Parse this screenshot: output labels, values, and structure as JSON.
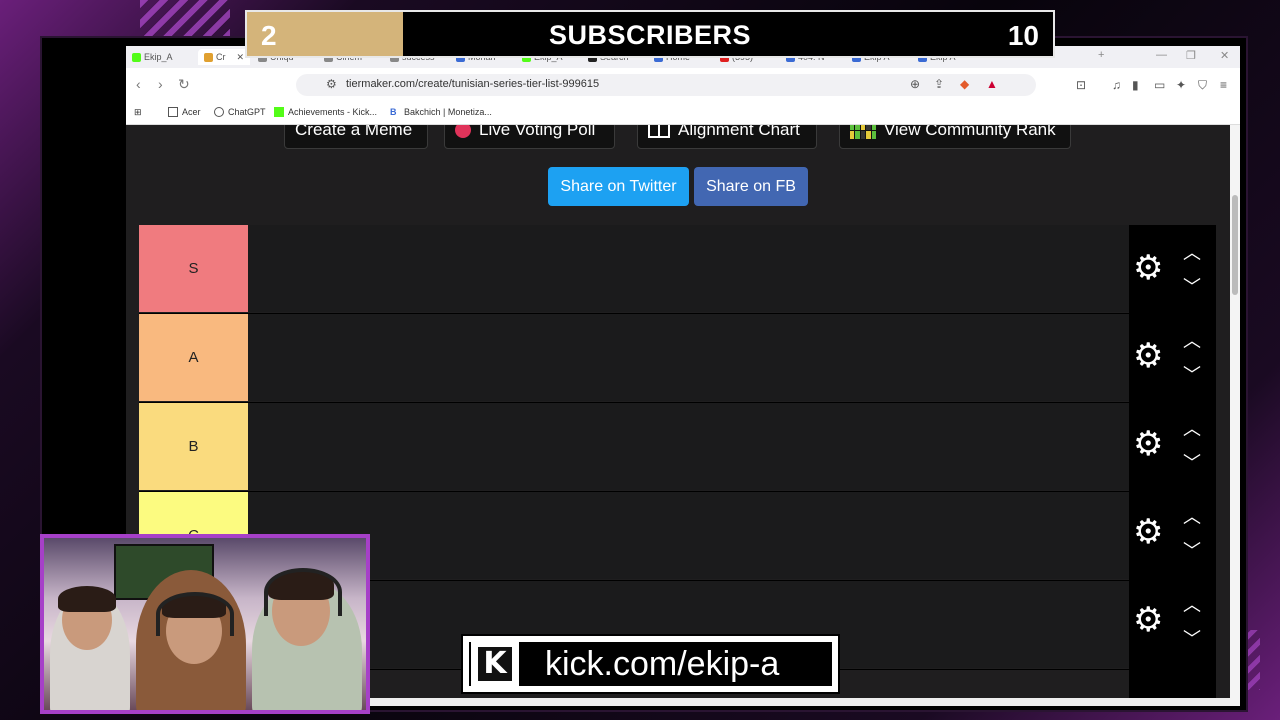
{
  "goal": {
    "current": "2",
    "title": "SUBSCRIBERS",
    "target": "10",
    "progress": 0.2
  },
  "browser": {
    "tabs": [
      {
        "label": "Ekip_A",
        "color": "#53fc18"
      },
      {
        "label": "Cr",
        "color": "#e0a030",
        "active": true
      },
      {
        "label": "Uniqu",
        "color": "#888888"
      },
      {
        "label": "Cinem",
        "color": "#888888"
      },
      {
        "label": "success",
        "color": "#888888"
      },
      {
        "label": "Mohan",
        "color": "#3a6ad4"
      },
      {
        "label": "Ekip_A",
        "color": "#53fc18"
      },
      {
        "label": "Search",
        "color": "#222222"
      },
      {
        "label": "Home",
        "color": "#3a6ad4"
      },
      {
        "label": "(395)",
        "color": "#e02020"
      },
      {
        "label": "404: N",
        "color": "#3a6ad4"
      },
      {
        "label": "Ekip A",
        "color": "#3a6ad4"
      },
      {
        "label": "Ekip A",
        "color": "#3a6ad4"
      }
    ],
    "url": "tiermaker.com/create/tunisian-series-tier-list-999615",
    "bookmarks": [
      {
        "label": "Acer",
        "icon": "folder-icon"
      },
      {
        "label": "ChatGPT",
        "icon": "chatgpt-icon"
      },
      {
        "label": "Achievements - Kick...",
        "icon": "kick-icon"
      },
      {
        "label": "Bakchich | Monetiza...",
        "icon": "b-icon"
      }
    ]
  },
  "page": {
    "top_buttons": [
      "Create a Meme",
      "Live Voting Poll",
      "Alignment Chart",
      "View Community Rank"
    ],
    "share_twitter": "Share on Twitter",
    "share_fb": "Share on FB",
    "tiers": [
      {
        "label": "S",
        "color": "#f07b7f"
      },
      {
        "label": "A",
        "color": "#f9b97f"
      },
      {
        "label": "B",
        "color": "#fadb7e"
      },
      {
        "label": "C",
        "color": "#fcfb80"
      },
      {
        "label": "",
        "color": "#1f1e1f"
      }
    ]
  },
  "overlay": {
    "kick_url": "kick.com/ekip-a",
    "kick_logo": "K"
  }
}
